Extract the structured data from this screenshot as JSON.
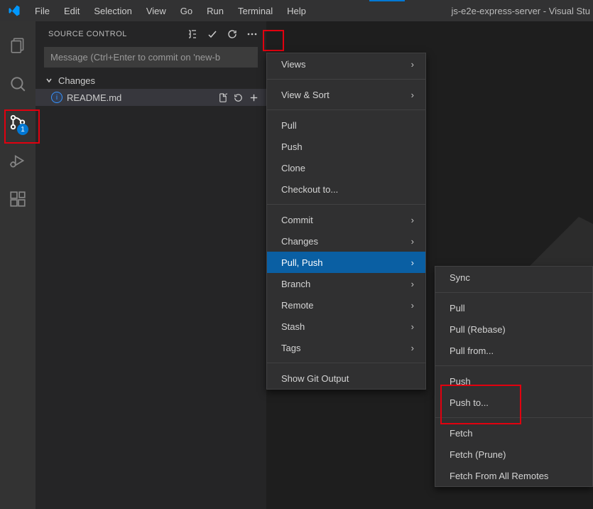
{
  "titlebar": {
    "menu": [
      "File",
      "Edit",
      "Selection",
      "View",
      "Go",
      "Run",
      "Terminal",
      "Help"
    ],
    "title": "js-e2e-express-server - Visual Stu"
  },
  "activitybar": {
    "badge": "1"
  },
  "scm": {
    "header": "SOURCE CONTROL",
    "message_placeholder": "Message (Ctrl+Enter to commit on 'new-b",
    "section": "Changes",
    "file": "README.md"
  },
  "menu1": {
    "views": "Views",
    "view_sort": "View & Sort",
    "pull": "Pull",
    "push": "Push",
    "clone": "Clone",
    "checkout": "Checkout to...",
    "commit": "Commit",
    "changes": "Changes",
    "pull_push": "Pull, Push",
    "branch": "Branch",
    "remote": "Remote",
    "stash": "Stash",
    "tags": "Tags",
    "show_output": "Show Git Output"
  },
  "menu2": {
    "sync": "Sync",
    "pull": "Pull",
    "pull_rebase": "Pull (Rebase)",
    "pull_from": "Pull from...",
    "push": "Push",
    "push_to": "Push to...",
    "fetch": "Fetch",
    "fetch_prune": "Fetch (Prune)",
    "fetch_all": "Fetch From All Remotes"
  }
}
